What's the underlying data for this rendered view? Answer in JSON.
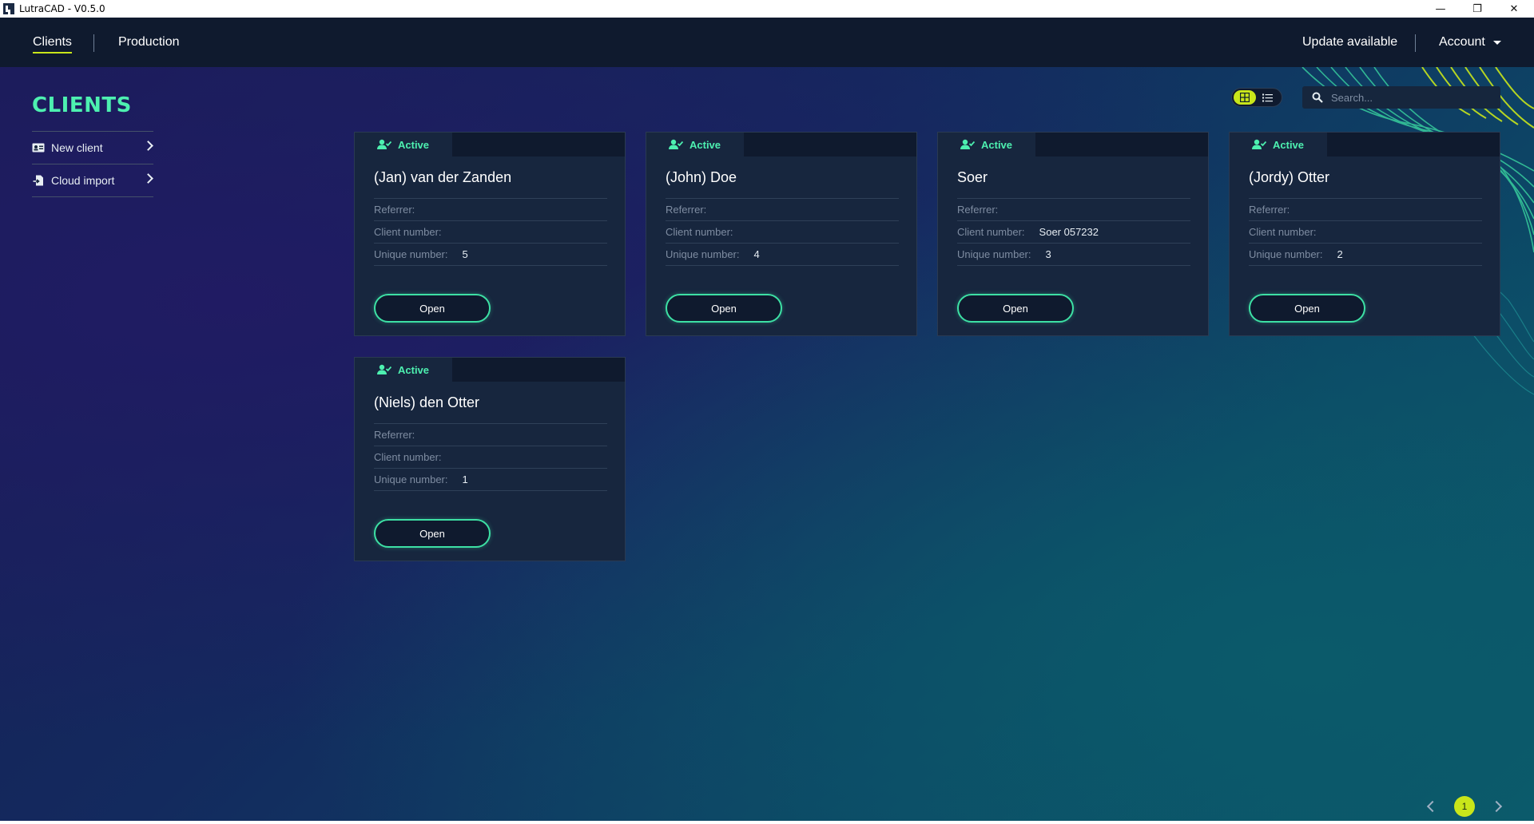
{
  "window": {
    "title": "LutraCAD - V0.5.0",
    "minimize": "—",
    "restore": "❐",
    "close": "✕"
  },
  "nav": {
    "tabs": [
      {
        "label": "Clients",
        "active": true
      },
      {
        "label": "Production",
        "active": false
      }
    ],
    "update_label": "Update available",
    "account_label": "Account"
  },
  "page": {
    "title": "CLIENTS"
  },
  "sidebar": {
    "items": [
      {
        "label": "New client",
        "icon": "id-card-icon"
      },
      {
        "label": "Cloud import",
        "icon": "file-import-icon"
      }
    ]
  },
  "search": {
    "placeholder": "Search..."
  },
  "view_toggle": {
    "active": "grid"
  },
  "labels": {
    "referrer": "Referrer:",
    "client_number": "Client number:",
    "unique_number": "Unique number:",
    "open": "Open"
  },
  "clients": [
    {
      "status": "Active",
      "name": "(Jan) van der Zanden",
      "referrer": "",
      "client_number": "",
      "unique_number": "5"
    },
    {
      "status": "Active",
      "name": "(John) Doe",
      "referrer": "",
      "client_number": "",
      "unique_number": "4"
    },
    {
      "status": "Active",
      "name": "Soer",
      "referrer": "",
      "client_number": "Soer 057232",
      "unique_number": "3"
    },
    {
      "status": "Active",
      "name": "(Jordy) Otter",
      "referrer": "",
      "client_number": "",
      "unique_number": "2"
    },
    {
      "status": "Active",
      "name": "(Niels) den Otter",
      "referrer": "",
      "client_number": "",
      "unique_number": "1"
    }
  ],
  "pagination": {
    "current": "1"
  },
  "colors": {
    "accent": "#c9e61a",
    "status": "#4df0b0",
    "card_bg": "#17263e",
    "nav_bg": "#0f1a2e"
  }
}
